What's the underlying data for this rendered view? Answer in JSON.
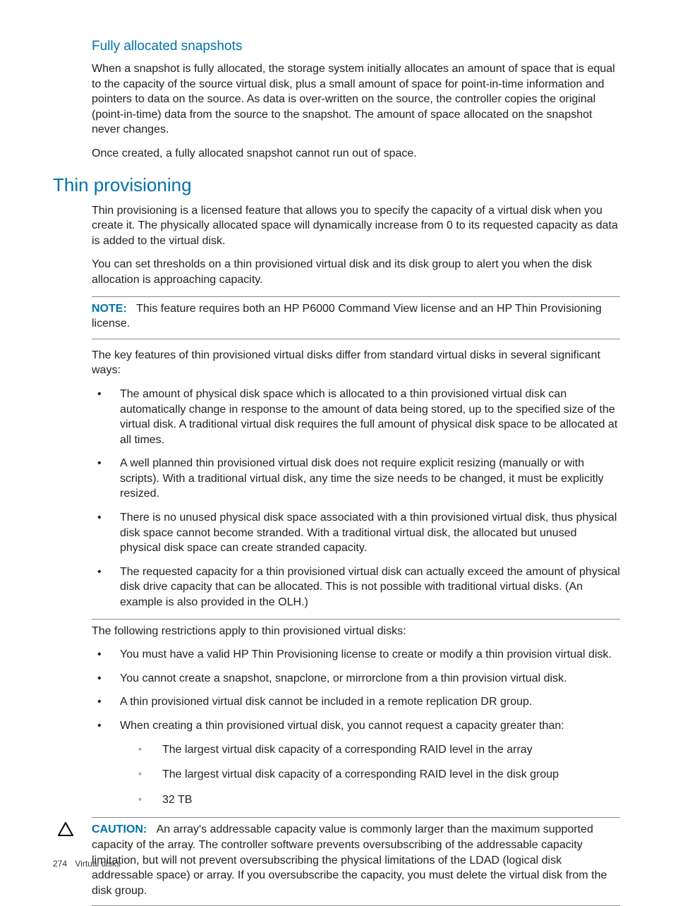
{
  "section1": {
    "heading": "Fully allocated snapshots",
    "p1": "When a snapshot is fully allocated, the storage system initially allocates an amount of space that is equal to the capacity of the source virtual disk, plus a small amount of space for point-in-time information and pointers to data on the source. As data is over-written on the source, the controller copies the original (point-in-time) data from the source to the snapshot. The amount of space allocated on the snapshot never changes.",
    "p2": "Once created, a fully allocated snapshot cannot run out of space."
  },
  "section2": {
    "heading": "Thin provisioning",
    "p1": "Thin provisioning is a licensed feature that allows you to specify the capacity of a virtual disk when you create it. The physically allocated space will dynamically increase from 0 to its requested capacity as data is added to the virtual disk.",
    "p2": "You can set thresholds on a thin provisioned virtual disk and its disk group to alert you when the disk allocation is approaching capacity.",
    "note_label": "NOTE:",
    "note_text": "This feature requires both an HP P6000 Command View license and an HP Thin Provisioning license.",
    "p3": "The key features of thin provisioned virtual disks differ from standard virtual disks in several significant ways:",
    "features": [
      "The amount of physical disk space which is allocated to a thin provisioned virtual disk can automatically change in response to the amount of data being stored, up to the specified size of the virtual disk. A traditional virtual disk requires the full amount of physical disk space to be allocated at all times.",
      "A well planned thin provisioned virtual disk does not require explicit resizing (manually or with scripts). With a traditional virtual disk, any time the size needs to be changed, it must be explicitly resized.",
      "There is no unused physical disk space associated with a thin provisioned virtual disk, thus physical disk space cannot become stranded. With a traditional virtual disk, the allocated but unused physical disk space can create stranded capacity.",
      "The requested capacity for a thin provisioned virtual disk can actually exceed the amount of physical disk drive capacity that can be allocated. This is not possible with traditional virtual disks. (An example is also provided in the OLH.)"
    ],
    "p4": "The following restrictions apply to thin provisioned virtual disks:",
    "restrictions": [
      "You must have a valid HP Thin Provisioning license to create or modify a thin provision virtual disk.",
      "You cannot create a snapshot, snapclone, or mirrorclone from a thin provision virtual disk.",
      "A thin provisioned virtual disk cannot be included in a remote replication DR group.",
      "When creating a thin provisioned virtual disk, you cannot request a capacity greater than:"
    ],
    "sub_restrictions": [
      "The largest virtual disk capacity of a corresponding RAID level in the array",
      "The largest virtual disk capacity of a corresponding RAID level in the disk group",
      "32 TB"
    ],
    "caution_label": "CAUTION:",
    "caution_text": "An array's addressable capacity value is commonly larger than the maximum supported capacity of the array. The controller software prevents oversubscribing of the addressable capacity limitation, but will not prevent oversubscribing the physical limitations of the LDAD (logical disk addressable space) or array. If you oversubscribe the capacity, you must delete the virtual disk from the disk group."
  },
  "footer": {
    "page": "274",
    "title": "Virtual disks"
  }
}
